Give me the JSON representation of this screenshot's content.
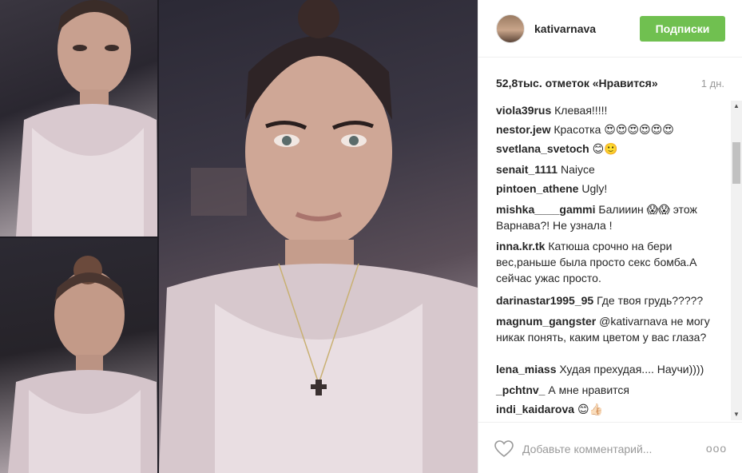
{
  "post": {
    "username": "kativarnava",
    "follow_label": "Подписки",
    "likes": "52,8тыс. отметок «Нравится»",
    "time": "1 дн."
  },
  "comments": [
    {
      "user": "viola39rus",
      "text": "Клевая!!!!!"
    },
    {
      "user": "nestor.jew",
      "text": "Красотка 😍😍😍😍😍😍"
    },
    {
      "user": "svetlana_svetoch",
      "text": "😊🙂"
    },
    {
      "user": "senait_1111",
      "text": "Naiyce"
    },
    {
      "user": "pintoen_athene",
      "text": "Ugly!"
    },
    {
      "user": "mishka____gammi",
      "text": "Балииин 😱😱 этож Варнава?! Не узнала !"
    },
    {
      "user": "inna.kr.tk",
      "text": "Катюша срочно на бери вес,раньше была просто секс бомба.А сейчас ужас просто."
    },
    {
      "user": "darinastar1995_95",
      "text": "Где твоя грудь?????"
    },
    {
      "user": "magnum_gangster",
      "text": "@kativarnava не могу никак понять, каким цветом у вас глаза?"
    },
    {
      "user": "lena_miass",
      "text": "Худая прехудая.... Научи))))"
    },
    {
      "user": "_pchtnv_",
      "text": "А мне нравится"
    },
    {
      "user": "indi_kaidarova",
      "text": "😊👍🏻"
    }
  ],
  "footer": {
    "placeholder": "Добавьте комментарий...",
    "more": "ooo"
  },
  "icons": {
    "heart": "heart-outline-icon",
    "more": "more-options-icon",
    "scroll_up": "scroll-up-arrow-icon",
    "scroll_down": "scroll-down-arrow-icon"
  },
  "colors": {
    "follow_button": "#70c050",
    "secondary_text": "#999999",
    "divider": "#efefef"
  }
}
